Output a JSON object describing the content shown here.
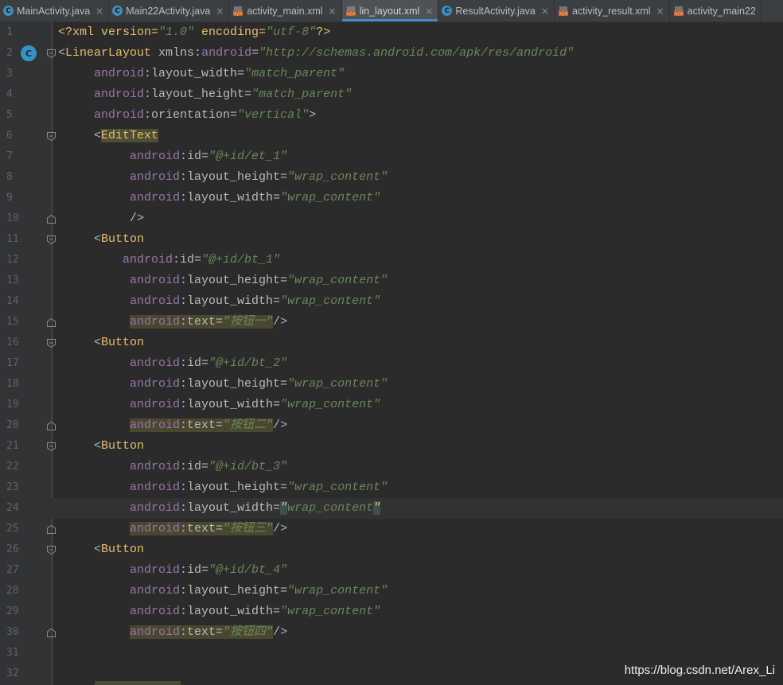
{
  "tabs": [
    {
      "label": "MainActivity.java",
      "icon": "class-icon",
      "active": false
    },
    {
      "label": "Main22Activity.java",
      "icon": "class-icon",
      "active": false
    },
    {
      "label": "activity_main.xml",
      "icon": "xml-file-icon",
      "active": false
    },
    {
      "label": "lin_layout.xml",
      "icon": "xml-file-icon",
      "active": true
    },
    {
      "label": "ResultActivity.java",
      "icon": "class-icon",
      "active": false
    },
    {
      "label": "activity_result.xml",
      "icon": "xml-file-icon",
      "active": false
    },
    {
      "label": "activity_main22",
      "icon": "xml-file-icon",
      "active": false
    }
  ],
  "tab_close_glyph": "×",
  "editor": {
    "gutter_marker": "C",
    "caret_line": 24,
    "lines": [
      {
        "n": "1",
        "parts": [
          {
            "t": "<?xml version=",
            "c": "t-pi"
          },
          {
            "t": "\"1.0\"",
            "c": "t-str"
          },
          {
            "t": " encoding=",
            "c": "t-pi"
          },
          {
            "t": "\"utf-8\"",
            "c": "t-str"
          },
          {
            "t": "?>",
            "c": "t-pi"
          }
        ]
      },
      {
        "n": "2",
        "parts": [
          {
            "t": "<",
            "c": "t-text"
          },
          {
            "t": "LinearLayout",
            "c": "t-tag"
          },
          {
            "t": " xmlns:",
            "c": "t-attr"
          },
          {
            "t": "android",
            "c": "t-ns"
          },
          {
            "t": "=",
            "c": "t-text"
          },
          {
            "t": "\"http://schemas.android.com/apk/res/android\"",
            "c": "t-str"
          }
        ]
      },
      {
        "n": "3",
        "parts": [
          {
            "t": "     ",
            "c": "t-text"
          },
          {
            "t": "android",
            "c": "t-ns"
          },
          {
            "t": ":layout_width=",
            "c": "t-attr"
          },
          {
            "t": "\"match_parent\"",
            "c": "t-str"
          }
        ]
      },
      {
        "n": "4",
        "parts": [
          {
            "t": "     ",
            "c": "t-text"
          },
          {
            "t": "android",
            "c": "t-ns"
          },
          {
            "t": ":layout_height=",
            "c": "t-attr"
          },
          {
            "t": "\"match_parent\"",
            "c": "t-str"
          }
        ]
      },
      {
        "n": "5",
        "parts": [
          {
            "t": "     ",
            "c": "t-text"
          },
          {
            "t": "android",
            "c": "t-ns"
          },
          {
            "t": ":orientation=",
            "c": "t-attr"
          },
          {
            "t": "\"vertical\"",
            "c": "t-str"
          },
          {
            "t": ">",
            "c": "t-text"
          }
        ]
      },
      {
        "n": "6",
        "parts": [
          {
            "t": "     <",
            "c": "t-text"
          },
          {
            "t": "EditText",
            "c": "t-tag hl-tag"
          }
        ]
      },
      {
        "n": "7",
        "parts": [
          {
            "t": "          ",
            "c": "t-text"
          },
          {
            "t": "android",
            "c": "t-ns"
          },
          {
            "t": ":id=",
            "c": "t-attr"
          },
          {
            "t": "\"@+id/et_1\"",
            "c": "t-str"
          }
        ]
      },
      {
        "n": "8",
        "parts": [
          {
            "t": "          ",
            "c": "t-text"
          },
          {
            "t": "android",
            "c": "t-ns"
          },
          {
            "t": ":layout_height=",
            "c": "t-attr"
          },
          {
            "t": "\"wrap_content\"",
            "c": "t-str"
          }
        ]
      },
      {
        "n": "9",
        "parts": [
          {
            "t": "          ",
            "c": "t-text"
          },
          {
            "t": "android",
            "c": "t-ns"
          },
          {
            "t": ":layout_width=",
            "c": "t-attr"
          },
          {
            "t": "\"wrap_content\"",
            "c": "t-str"
          }
        ]
      },
      {
        "n": "10",
        "parts": [
          {
            "t": "          />",
            "c": "t-text"
          }
        ]
      },
      {
        "n": "11",
        "parts": [
          {
            "t": "     <",
            "c": "t-text"
          },
          {
            "t": "Button",
            "c": "t-tag"
          }
        ]
      },
      {
        "n": "12",
        "parts": [
          {
            "t": "         ",
            "c": "t-text"
          },
          {
            "t": "android",
            "c": "t-ns"
          },
          {
            "t": ":id=",
            "c": "t-attr"
          },
          {
            "t": "\"@+id/bt_1\"",
            "c": "t-str"
          }
        ]
      },
      {
        "n": "13",
        "parts": [
          {
            "t": "          ",
            "c": "t-text"
          },
          {
            "t": "android",
            "c": "t-ns"
          },
          {
            "t": ":layout_height=",
            "c": "t-attr"
          },
          {
            "t": "\"wrap_content\"",
            "c": "t-str"
          }
        ]
      },
      {
        "n": "14",
        "parts": [
          {
            "t": "          ",
            "c": "t-text"
          },
          {
            "t": "android",
            "c": "t-ns"
          },
          {
            "t": ":layout_width=",
            "c": "t-attr"
          },
          {
            "t": "\"wrap_content\"",
            "c": "t-str"
          }
        ]
      },
      {
        "n": "15",
        "parts": [
          {
            "t": "          ",
            "c": "t-text"
          },
          {
            "t": "android",
            "c": "t-ns hl-attr"
          },
          {
            "t": ":text=",
            "c": "t-attr hl-attr"
          },
          {
            "t": "\"按钮一\"",
            "c": "t-str hl-attr"
          },
          {
            "t": "/>",
            "c": "t-text"
          }
        ]
      },
      {
        "n": "16",
        "parts": [
          {
            "t": "     <",
            "c": "t-text"
          },
          {
            "t": "Button",
            "c": "t-tag"
          }
        ]
      },
      {
        "n": "17",
        "parts": [
          {
            "t": "          ",
            "c": "t-text"
          },
          {
            "t": "android",
            "c": "t-ns"
          },
          {
            "t": ":id=",
            "c": "t-attr"
          },
          {
            "t": "\"@+id/bt_2\"",
            "c": "t-str"
          }
        ]
      },
      {
        "n": "18",
        "parts": [
          {
            "t": "          ",
            "c": "t-text"
          },
          {
            "t": "android",
            "c": "t-ns"
          },
          {
            "t": ":layout_height=",
            "c": "t-attr"
          },
          {
            "t": "\"wrap_content\"",
            "c": "t-str"
          }
        ]
      },
      {
        "n": "19",
        "parts": [
          {
            "t": "          ",
            "c": "t-text"
          },
          {
            "t": "android",
            "c": "t-ns"
          },
          {
            "t": ":layout_width=",
            "c": "t-attr"
          },
          {
            "t": "\"wrap_content\"",
            "c": "t-str"
          }
        ]
      },
      {
        "n": "20",
        "parts": [
          {
            "t": "          ",
            "c": "t-text"
          },
          {
            "t": "android",
            "c": "t-ns hl-attr"
          },
          {
            "t": ":text=",
            "c": "t-attr hl-attr"
          },
          {
            "t": "\"按钮二\"",
            "c": "t-str hl-attr"
          },
          {
            "t": "/>",
            "c": "t-text"
          }
        ]
      },
      {
        "n": "21",
        "parts": [
          {
            "t": "     <",
            "c": "t-text"
          },
          {
            "t": "Button",
            "c": "t-tag"
          }
        ]
      },
      {
        "n": "22",
        "parts": [
          {
            "t": "          ",
            "c": "t-text"
          },
          {
            "t": "android",
            "c": "t-ns"
          },
          {
            "t": ":id=",
            "c": "t-attr"
          },
          {
            "t": "\"@+id/bt_3\"",
            "c": "t-str"
          }
        ]
      },
      {
        "n": "23",
        "parts": [
          {
            "t": "          ",
            "c": "t-text"
          },
          {
            "t": "android",
            "c": "t-ns"
          },
          {
            "t": ":layout_height=",
            "c": "t-attr"
          },
          {
            "t": "\"wrap_content\"",
            "c": "t-str"
          }
        ]
      },
      {
        "n": "24",
        "parts": [
          {
            "t": "          ",
            "c": "t-text"
          },
          {
            "t": "android",
            "c": "t-ns"
          },
          {
            "t": ":layout_width=",
            "c": "t-attr"
          },
          {
            "t": "\"",
            "c": "t-caretq"
          },
          {
            "t": "wrap_content",
            "c": "t-str"
          },
          {
            "t": "\"",
            "c": "t-caretq"
          }
        ]
      },
      {
        "n": "25",
        "parts": [
          {
            "t": "          ",
            "c": "t-text"
          },
          {
            "t": "android",
            "c": "t-ns hl-attr"
          },
          {
            "t": ":text=",
            "c": "t-attr hl-attr"
          },
          {
            "t": "\"按钮三\"",
            "c": "t-str hl-attr"
          },
          {
            "t": "/>",
            "c": "t-text"
          }
        ]
      },
      {
        "n": "26",
        "parts": [
          {
            "t": "     <",
            "c": "t-text"
          },
          {
            "t": "Button",
            "c": "t-tag"
          }
        ]
      },
      {
        "n": "27",
        "parts": [
          {
            "t": "          ",
            "c": "t-text"
          },
          {
            "t": "android",
            "c": "t-ns"
          },
          {
            "t": ":id=",
            "c": "t-attr"
          },
          {
            "t": "\"@+id/bt_4\"",
            "c": "t-str"
          }
        ]
      },
      {
        "n": "28",
        "parts": [
          {
            "t": "          ",
            "c": "t-text"
          },
          {
            "t": "android",
            "c": "t-ns"
          },
          {
            "t": ":layout_height=",
            "c": "t-attr"
          },
          {
            "t": "\"wrap_content\"",
            "c": "t-str"
          }
        ]
      },
      {
        "n": "29",
        "parts": [
          {
            "t": "          ",
            "c": "t-text"
          },
          {
            "t": "android",
            "c": "t-ns"
          },
          {
            "t": ":layout_width=",
            "c": "t-attr"
          },
          {
            "t": "\"wrap_content\"",
            "c": "t-str"
          }
        ]
      },
      {
        "n": "30",
        "parts": [
          {
            "t": "          ",
            "c": "t-text"
          },
          {
            "t": "android",
            "c": "t-ns hl-attr"
          },
          {
            "t": ":text=",
            "c": "t-attr hl-attr"
          },
          {
            "t": "\"按钮四\"",
            "c": "t-str hl-attr"
          },
          {
            "t": "/>",
            "c": "t-text"
          }
        ]
      },
      {
        "n": "31",
        "parts": []
      },
      {
        "n": "32",
        "parts": []
      }
    ],
    "fold_lines": [
      2,
      6,
      10,
      11,
      15,
      16,
      20,
      21,
      25,
      26,
      30
    ],
    "fold_open_lines": [
      2,
      6,
      11,
      16,
      21,
      26
    ],
    "marker_line": 2
  },
  "watermark": "https://blog.csdn.net/Arex_Li",
  "colors": {
    "accent": "#4a88c7",
    "background": "#2b2b2b",
    "gutter": "#313335"
  }
}
